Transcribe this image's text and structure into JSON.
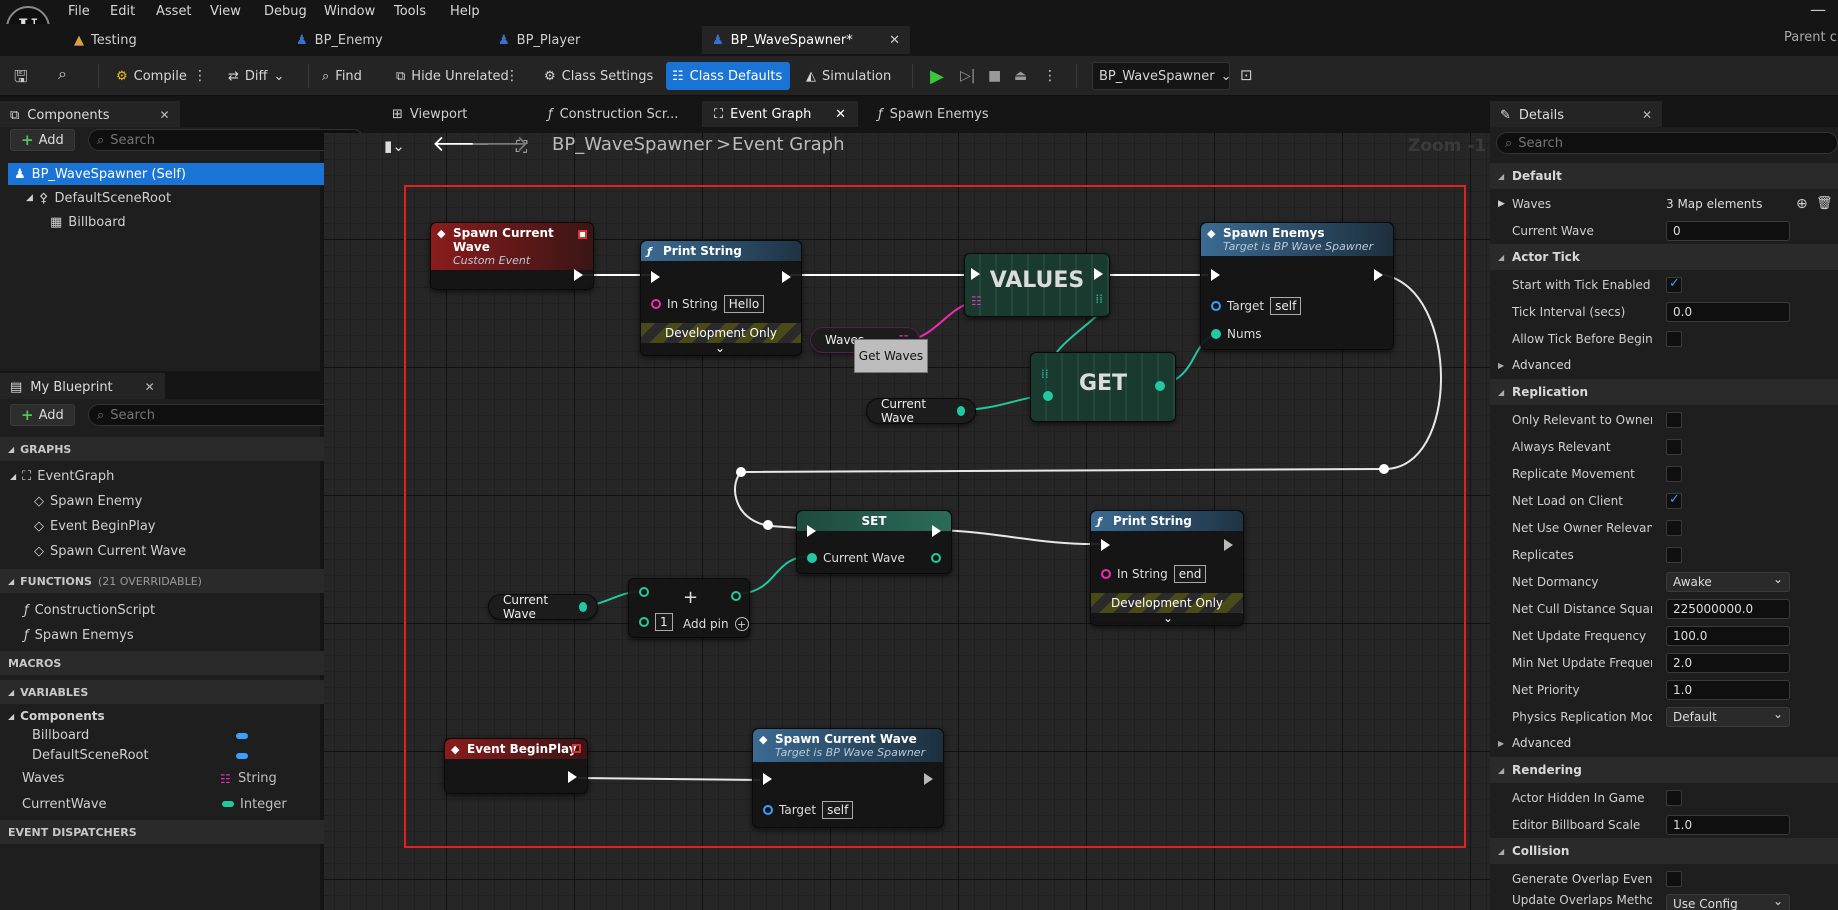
{
  "menu": [
    "File",
    "Edit",
    "Asset",
    "View",
    "Debug",
    "Window",
    "Tools",
    "Help"
  ],
  "doc_tabs": [
    {
      "label": "Testing"
    },
    {
      "label": "BP_Enemy"
    },
    {
      "label": "BP_Player"
    },
    {
      "label": "BP_WaveSpawner*"
    }
  ],
  "parent_label": "Parent c",
  "toolbar": {
    "compile": "Compile",
    "diff": "Diff",
    "find": "Find",
    "hide_unrelated": "Hide Unrelated",
    "class_settings": "Class Settings",
    "class_defaults": "Class Defaults",
    "simulation": "Simulation",
    "debug_object": "BP_WaveSpawner"
  },
  "components": {
    "title": "Components",
    "add": "Add",
    "search_placeholder": "Search",
    "items": [
      "BP_WaveSpawner (Self)",
      "DefaultSceneRoot",
      "Billboard"
    ]
  },
  "my_blueprint": {
    "title": "My Blueprint",
    "add": "Add",
    "search_placeholder": "Search",
    "graphs_header": "GRAPHS",
    "graphs": [
      "EventGraph",
      "Spawn Enemy",
      "Event BeginPlay",
      "Spawn Current Wave"
    ],
    "functions_header": "FUNCTIONS",
    "functions_sub": "(21 OVERRIDABLE)",
    "functions": [
      "ConstructionScript",
      "Spawn Enemys"
    ],
    "macros_header": "MACROS",
    "variables_header": "VARIABLES",
    "var_category": "Components",
    "component_vars": [
      "Billboard",
      "DefaultSceneRoot"
    ],
    "variables": [
      {
        "name": "Waves",
        "type": "String"
      },
      {
        "name": "CurrentWave",
        "type": "Integer"
      }
    ],
    "dispatchers_header": "EVENT DISPATCHERS"
  },
  "graph_tabs": [
    "Viewport",
    "Construction Scr...",
    "Event Graph",
    "Spawn Enemys"
  ],
  "breadcrumb": {
    "blueprint": "BP_WaveSpawner",
    "graph": "Event Graph",
    "zoom": "Zoom -1"
  },
  "nodes": {
    "spawn_current_wave_event": {
      "title": "Spawn Current Wave",
      "sub": "Custom Event"
    },
    "print_hello": {
      "title": "Print String",
      "in_label": "In String",
      "in_value": "Hello",
      "dev": "Development Only"
    },
    "values": {
      "title": "VALUES"
    },
    "spawn_enemys": {
      "title": "Spawn Enemys",
      "sub": "Target is BP Wave Spawner",
      "target_label": "Target",
      "target_value": "self",
      "nums": "Nums"
    },
    "waves_var": {
      "label": "Waves",
      "tooltip": "Get Waves"
    },
    "get": {
      "title": "GET"
    },
    "current_wave_1": {
      "label": "Current Wave"
    },
    "set": {
      "title": "SET",
      "pin": "Current Wave"
    },
    "print_end": {
      "title": "Print String",
      "in_label": "In String",
      "in_value": "end",
      "dev": "Development Only"
    },
    "current_wave_2": {
      "label": "Current Wave"
    },
    "add": {
      "value": "1",
      "add_pin": "Add pin"
    },
    "begin_play": {
      "title": "Event BeginPlay"
    },
    "spawn_current_wave_call": {
      "title": "Spawn Current Wave",
      "sub": "Target is BP Wave Spawner",
      "target_label": "Target",
      "target_value": "self"
    }
  },
  "details": {
    "title": "Details",
    "search_placeholder": "Search",
    "sections": {
      "default": "Default",
      "actor_tick": "Actor Tick",
      "advanced": "Advanced",
      "replication": "Replication",
      "advanced2": "Advanced",
      "rendering": "Rendering",
      "collision": "Collision"
    },
    "rows": {
      "waves": {
        "label": "Waves",
        "value": "3 Map elements"
      },
      "current_wave": {
        "label": "Current Wave",
        "value": "0"
      },
      "start_tick": {
        "label": "Start with Tick Enabled"
      },
      "tick_interval": {
        "label": "Tick Interval (secs)",
        "value": "0.0"
      },
      "allow_tick": {
        "label": "Allow Tick Before Begin Pl..."
      },
      "only_relevant": {
        "label": "Only Relevant to Owner"
      },
      "always_relevant": {
        "label": "Always Relevant"
      },
      "replicate_movement": {
        "label": "Replicate Movement"
      },
      "net_load": {
        "label": "Net Load on Client"
      },
      "net_owner": {
        "label": "Net Use Owner Relevancy"
      },
      "replicates": {
        "label": "Replicates"
      },
      "net_dormancy": {
        "label": "Net Dormancy",
        "value": "Awake"
      },
      "net_cull": {
        "label": "Net Cull Distance Squared",
        "value": "225000000.0"
      },
      "net_update": {
        "label": "Net Update Frequency",
        "value": "100.0"
      },
      "min_net_update": {
        "label": "Min Net Update Frequency",
        "value": "2.0"
      },
      "net_priority": {
        "label": "Net Priority",
        "value": "1.0"
      },
      "physics_rep": {
        "label": "Physics Replication Mode",
        "value": "Default"
      },
      "actor_hidden": {
        "label": "Actor Hidden In Game"
      },
      "billboard_scale": {
        "label": "Editor Billboard Scale",
        "value": "1.0"
      },
      "gen_overlap": {
        "label": "Generate Overlap Events..."
      },
      "update_overlap": {
        "label": "Update Overlaps Method...",
        "value": "Use Config Default"
      }
    }
  },
  "colors": {
    "accent": "#1a74d6",
    "selection": "#e41f1f",
    "exec": "#ffffff",
    "integer": "#23c8a0",
    "string": "#f02ab4",
    "object": "#3aa0ff"
  }
}
